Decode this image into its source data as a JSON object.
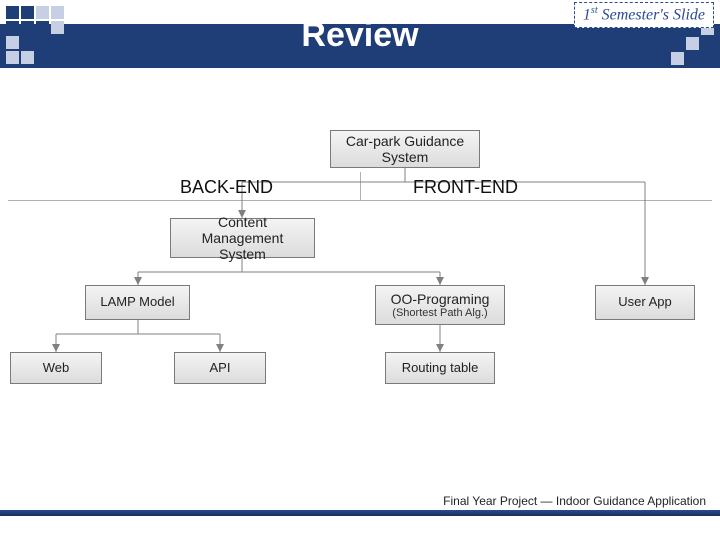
{
  "header": {
    "title": "Review",
    "badge_prefix": "1",
    "badge_sup": "st",
    "badge_rest": " Semester's Slide"
  },
  "sections": {
    "back": "BACK-END",
    "front": "FRONT-END"
  },
  "nodes": {
    "root_l1": "Car-park Guidance",
    "root_l2": "System",
    "cms_l1": "Content",
    "cms_l2": "Management System",
    "lamp": "LAMP Model",
    "oo_l1": "OO-Programing",
    "oo_l2": "(Shortest Path Alg.)",
    "user": "User App",
    "web": "Web",
    "api": "API",
    "routing": "Routing table"
  },
  "footer": {
    "text": "Final Year Project — Indoor Guidance Application"
  },
  "colors": {
    "brand": "#1f3d77"
  }
}
